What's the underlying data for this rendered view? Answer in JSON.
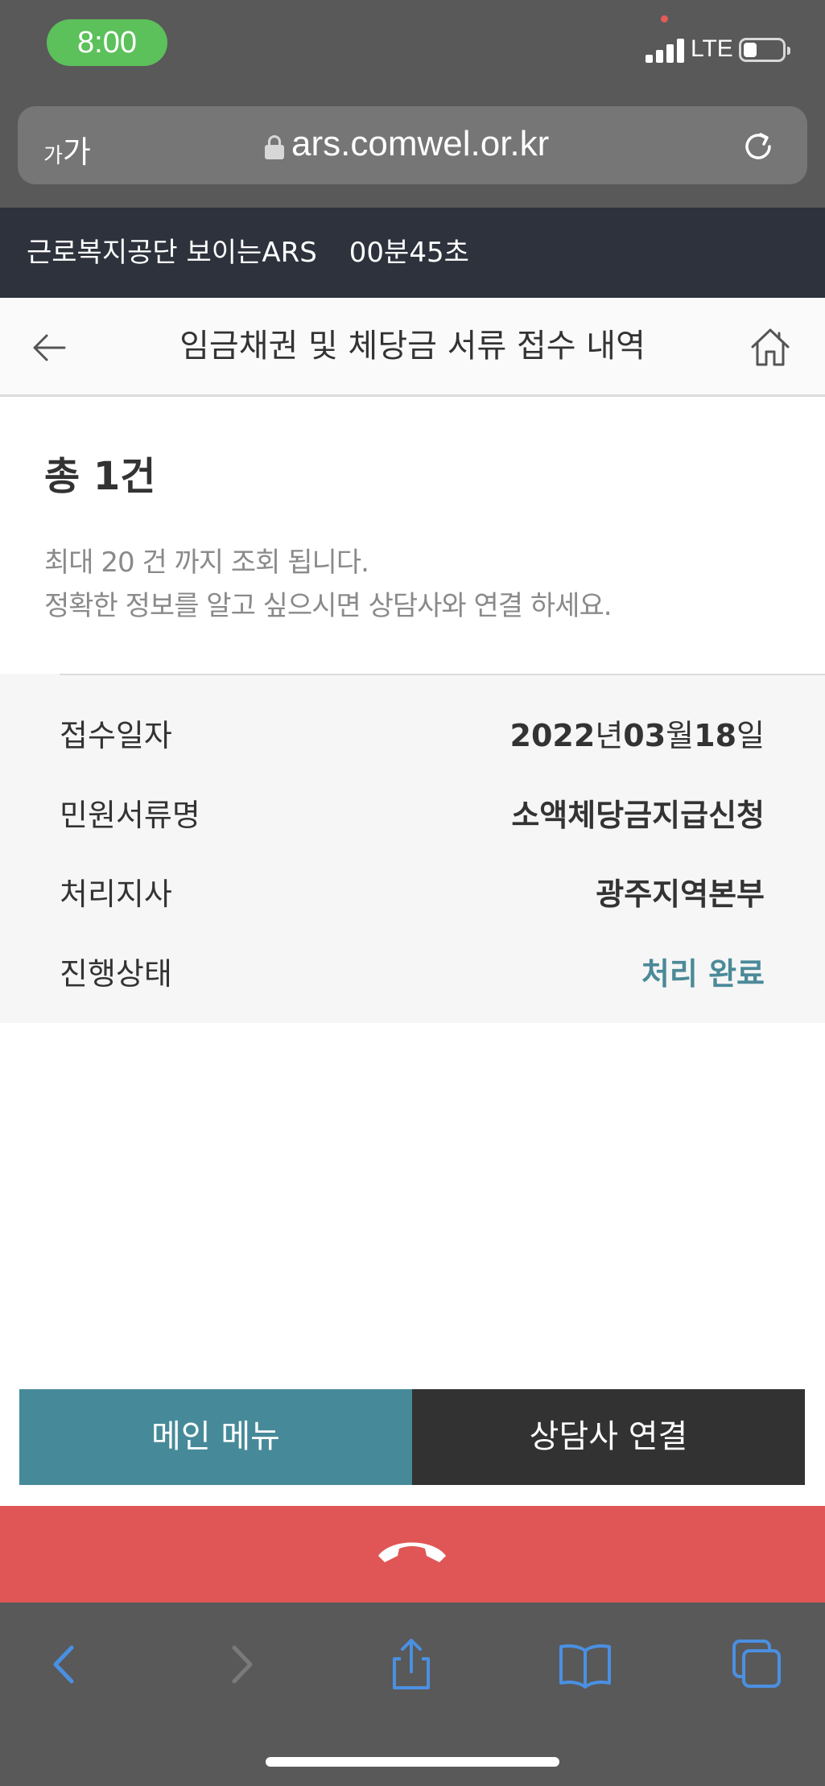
{
  "status_bar": {
    "time": "8:00",
    "network": "LTE",
    "battery_level": 0.35
  },
  "browser": {
    "text_size_small": "가",
    "text_size_large": "가",
    "url": "ars.comwel.or.kr"
  },
  "banner": {
    "title": "근로복지공단 보이는ARS",
    "timer": "00분45초"
  },
  "header": {
    "title": "임금채권 및 체당금 서류 접수 내역"
  },
  "summary": {
    "total": "총 1건",
    "notice_line1": "최대 20 건 까지 조회 됩니다.",
    "notice_line2": "정확한 정보를 알고 싶으시면 상담사와 연결 하세요."
  },
  "record": {
    "date_label": "접수일자",
    "date": {
      "year": "2022",
      "year_unit": "년",
      "month": "03",
      "month_unit": "월",
      "day": "18",
      "day_unit": "일"
    },
    "doc_label": "민원서류명",
    "doc_value": "소액체당금지급신청",
    "branch_label": "처리지사",
    "branch_value": "광주지역본부",
    "status_label": "진행상태",
    "status_value": "처리 완료"
  },
  "buttons": {
    "main_menu": "메인 메뉴",
    "counselor": "상담사 연결"
  },
  "colors": {
    "accent_teal": "#468a99",
    "hangup_red": "#e05656",
    "banner_dark": "#2d323c",
    "safari_blue": "#4a90e2"
  },
  "icons": [
    "back-arrow-icon",
    "home-icon",
    "lock-icon",
    "reload-icon",
    "phone-hangup-icon",
    "share-icon",
    "bookmarks-icon",
    "tabs-icon"
  ]
}
